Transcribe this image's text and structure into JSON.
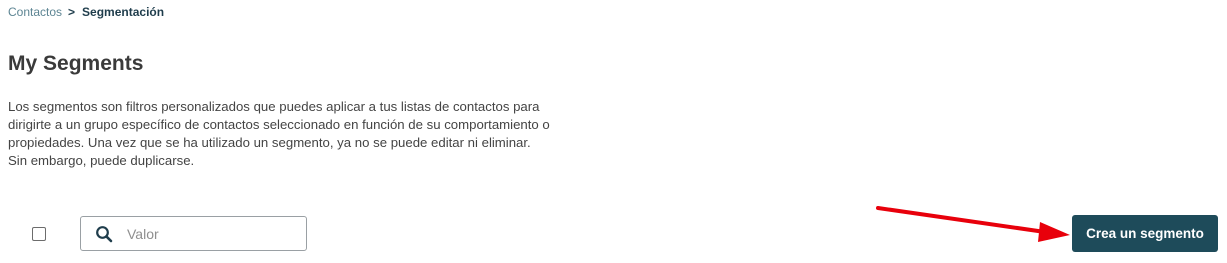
{
  "breadcrumb": {
    "parent": "Contactos",
    "separator": ">",
    "current": "Segmentación"
  },
  "page": {
    "title": "My Segments",
    "description": "Los segmentos son filtros personalizados que puedes aplicar a tus listas de contactos para dirigirte a un grupo específico de contactos seleccionado en función de su comportamiento o propiedades. Una vez que se ha utilizado un segmento, ya no se puede editar ni eliminar. Sin embargo, puede duplicarse."
  },
  "toolbar": {
    "select_all_checked": false,
    "search_placeholder": "Valor",
    "search_icon": "search-icon",
    "create_button_label": "Crea un segmento"
  },
  "colors": {
    "primary": "#1e4b5a",
    "breadcrumb_link": "#5d8593",
    "annotation_arrow": "#e8000b"
  }
}
